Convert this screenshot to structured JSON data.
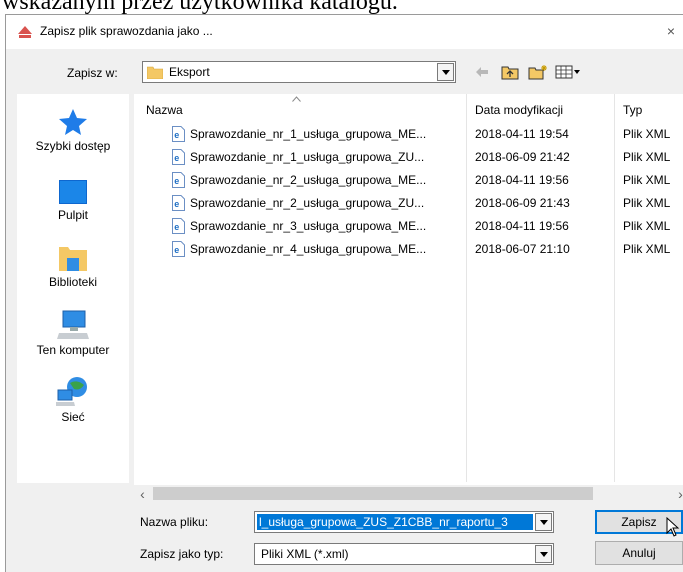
{
  "background_text": "wskazanym przez użytkownika katalogu.",
  "dialog": {
    "title": "Zapisz plik sprawozdania jako ...",
    "close_label": "×"
  },
  "location": {
    "label": "Zapisz w:",
    "value": "Eksport"
  },
  "toolbar": {
    "icons": [
      "back-arrow-icon",
      "up-folder-icon",
      "new-folder-icon",
      "view-menu-icon"
    ]
  },
  "sidebar": {
    "items": [
      {
        "label": "Szybki dostęp",
        "icon": "star-icon"
      },
      {
        "label": "Pulpit",
        "icon": "desktop-icon"
      },
      {
        "label": "Biblioteki",
        "icon": "libraries-icon"
      },
      {
        "label": "Ten komputer",
        "icon": "computer-icon"
      },
      {
        "label": "Sieć",
        "icon": "network-icon"
      }
    ]
  },
  "filelist": {
    "columns": [
      "Nazwa",
      "Data modyfikacji",
      "Typ"
    ],
    "rows": [
      {
        "name": "Sprawozdanie_nr_1_usługa_grupowa_ME...",
        "date": "2018-04-11 19:54",
        "type": "Plik XML"
      },
      {
        "name": "Sprawozdanie_nr_1_usługa_grupowa_ZU...",
        "date": "2018-06-09 21:42",
        "type": "Plik XML"
      },
      {
        "name": "Sprawozdanie_nr_2_usługa_grupowa_ME...",
        "date": "2018-04-11 19:56",
        "type": "Plik XML"
      },
      {
        "name": "Sprawozdanie_nr_2_usługa_grupowa_ZU...",
        "date": "2018-06-09 21:43",
        "type": "Plik XML"
      },
      {
        "name": "Sprawozdanie_nr_3_usługa_grupowa_ME...",
        "date": "2018-04-11 19:56",
        "type": "Plik XML"
      },
      {
        "name": "Sprawozdanie_nr_4_usługa_grupowa_ME...",
        "date": "2018-06-07 21:10",
        "type": "Plik XML"
      }
    ]
  },
  "scroll": {
    "left_arrow": "‹",
    "right_arrow": "›"
  },
  "filename": {
    "label": "Nazwa pliku:",
    "value": "l_usługa_grupowa_ZUS_Z1CBB_nr_raportu_3"
  },
  "filetype": {
    "label": "Zapisz jako typ:",
    "value": "Pliki XML (*.xml)"
  },
  "buttons": {
    "save": "Zapisz",
    "cancel": "Anuluj"
  },
  "colors": {
    "selection": "#0078d7",
    "accent_red": "#d9534f"
  }
}
